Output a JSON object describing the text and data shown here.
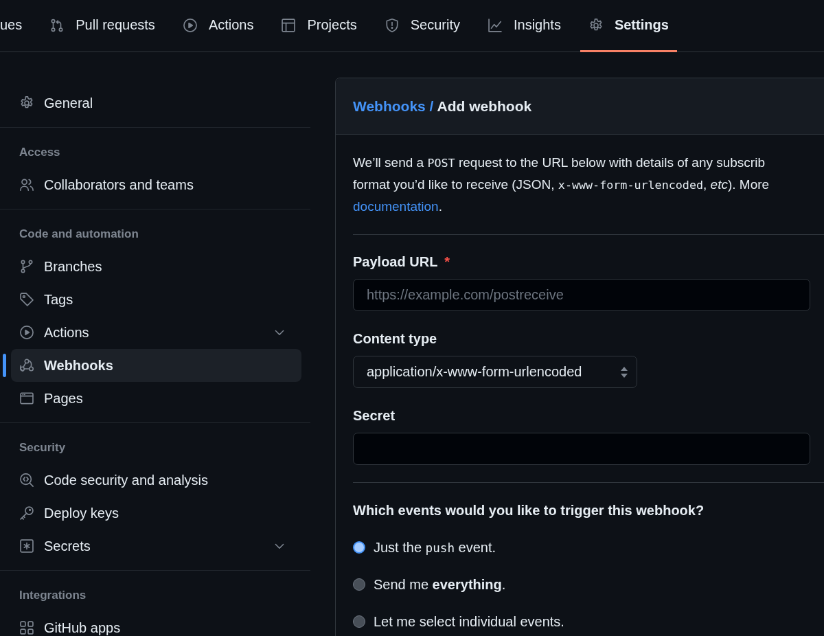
{
  "nav_tabs": [
    {
      "label": "ues",
      "selected": false
    },
    {
      "label": "Pull requests",
      "selected": false
    },
    {
      "label": "Actions",
      "selected": false
    },
    {
      "label": "Projects",
      "selected": false
    },
    {
      "label": "Security",
      "selected": false
    },
    {
      "label": "Insights",
      "selected": false
    },
    {
      "label": "Settings",
      "selected": true
    }
  ],
  "sidebar": {
    "sections": [
      {
        "items": [
          {
            "label": "General",
            "selected": false,
            "expandable": false
          }
        ]
      },
      {
        "heading": "Access",
        "items": [
          {
            "label": "Collaborators and teams",
            "selected": false,
            "expandable": false
          }
        ]
      },
      {
        "heading": "Code and automation",
        "items": [
          {
            "label": "Branches",
            "selected": false,
            "expandable": false
          },
          {
            "label": "Tags",
            "selected": false,
            "expandable": false
          },
          {
            "label": "Actions",
            "selected": false,
            "expandable": true
          },
          {
            "label": "Webhooks",
            "selected": true,
            "expandable": false
          },
          {
            "label": "Pages",
            "selected": false,
            "expandable": false
          }
        ]
      },
      {
        "heading": "Security",
        "items": [
          {
            "label": "Code security and analysis",
            "selected": false,
            "expandable": false
          },
          {
            "label": "Deploy keys",
            "selected": false,
            "expandable": false
          },
          {
            "label": "Secrets",
            "selected": false,
            "expandable": true
          }
        ]
      },
      {
        "heading": "Integrations",
        "items": [
          {
            "label": "GitHub apps",
            "selected": false,
            "expandable": false
          }
        ]
      }
    ]
  },
  "panel": {
    "breadcrumb": {
      "parent": "Webhooks",
      "separator": "/",
      "current": "Add webhook"
    },
    "description": {
      "lines": [
        [
          {
            "kind": "text",
            "text": "We’ll send a "
          },
          {
            "kind": "code",
            "text": "POST"
          },
          {
            "kind": "text",
            "text": " request to the URL below with details of any subscrib"
          }
        ],
        [
          {
            "kind": "text",
            "text": "format you’d like to receive (JSON, "
          },
          {
            "kind": "code",
            "text": "x-www-form-urlencoded"
          },
          {
            "kind": "text",
            "text": ", *etc*). More"
          }
        ],
        [
          {
            "kind": "link",
            "text": "documentation"
          },
          {
            "kind": "text",
            "text": "."
          }
        ]
      ]
    },
    "fields": [
      {
        "kind": "text",
        "label": "Payload URL",
        "required_mark": "*",
        "placeholder": "https://example.com/postreceive"
      },
      {
        "kind": "select",
        "label": "Content type",
        "value": "application/x-www-form-urlencoded"
      },
      {
        "kind": "text",
        "label": "Secret"
      }
    ],
    "events": {
      "question": "Which events would you like to trigger this webhook?",
      "options": [
        {
          "selected": true,
          "label": [
            {
              "kind": "text",
              "text": "Just the "
            },
            {
              "kind": "code",
              "text": "push"
            },
            {
              "kind": "text",
              "text": " event."
            }
          ]
        },
        {
          "selected": false,
          "label": [
            {
              "kind": "text",
              "text": "Send me **everything**."
            }
          ]
        },
        {
          "selected": false,
          "label": [
            {
              "kind": "text",
              "text": "Let me select individual events."
            }
          ]
        }
      ]
    }
  }
}
